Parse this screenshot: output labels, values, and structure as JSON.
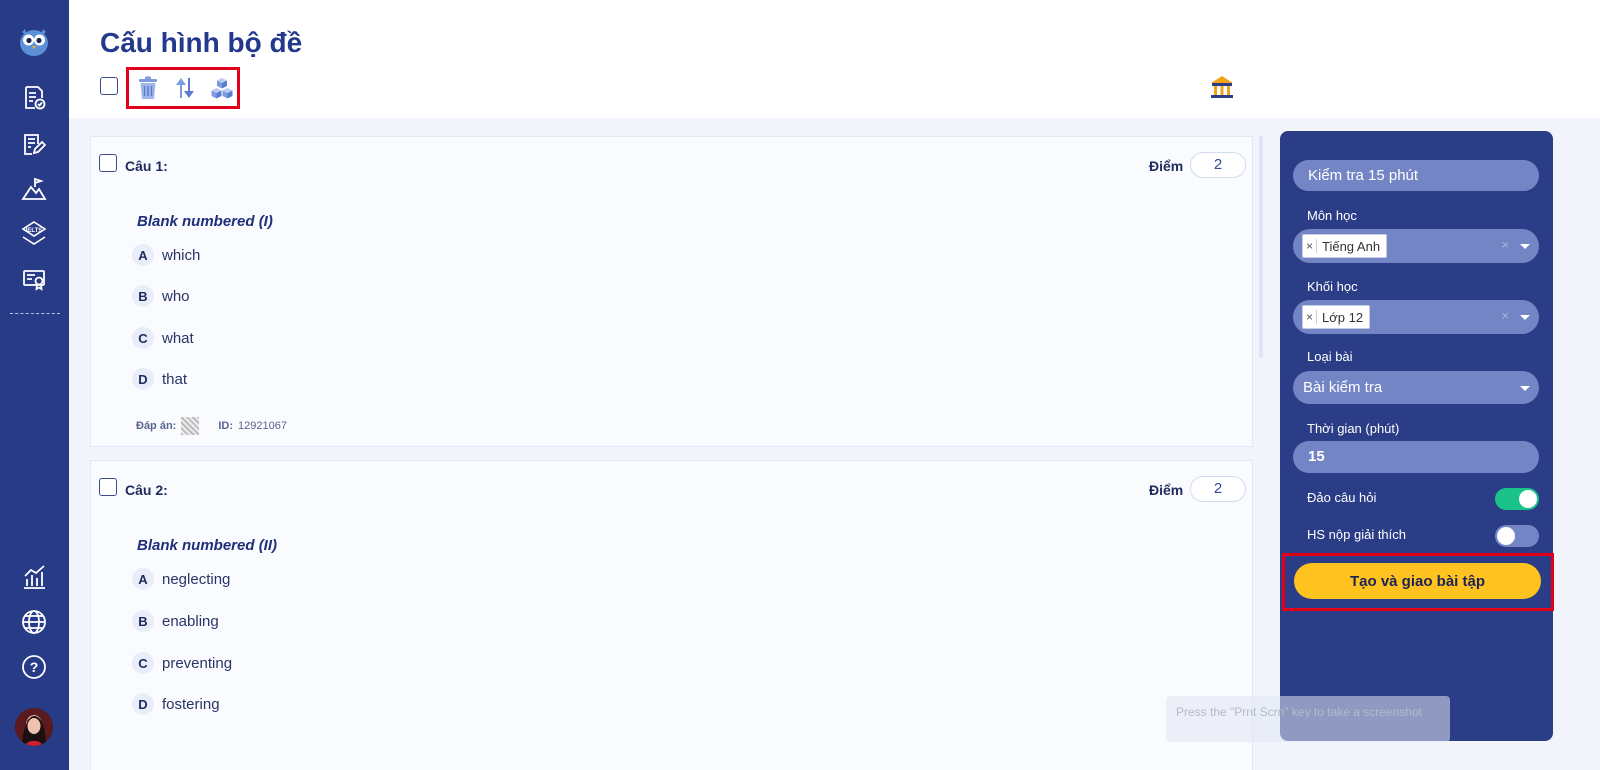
{
  "header": {
    "title": "Cấu hình bộ đề"
  },
  "sidebar": {
    "items": [
      "logo-owl",
      "exam-list",
      "edit-document",
      "mountain-flag",
      "ielts",
      "certificate",
      "analytics",
      "globe",
      "help"
    ]
  },
  "ielts_label": "IELTS",
  "questions": [
    {
      "label": "Câu 1:",
      "score_label": "Điểm",
      "score": "2",
      "text": "Blank numbered (I)",
      "options": [
        {
          "letter": "A",
          "text": "which"
        },
        {
          "letter": "B",
          "text": "who"
        },
        {
          "letter": "C",
          "text": "what"
        },
        {
          "letter": "D",
          "text": "that"
        }
      ],
      "answer_label": "Đáp án:",
      "id_label": "ID:",
      "id": "12921067"
    },
    {
      "label": "Câu 2:",
      "score_label": "Điểm",
      "score": "2",
      "text": "Blank numbered (II)",
      "options": [
        {
          "letter": "A",
          "text": "neglecting"
        },
        {
          "letter": "B",
          "text": "enabling"
        },
        {
          "letter": "C",
          "text": "preventing"
        },
        {
          "letter": "D",
          "text": "fostering"
        }
      ]
    }
  ],
  "panel": {
    "title": "Kiểm tra 15 phút",
    "subject_label": "Môn học",
    "subject_tag": "Tiếng Anh",
    "grade_label": "Khối học",
    "grade_tag": "Lớp 12",
    "tag_remove": "×",
    "clear": "×",
    "type_label": "Loại bài",
    "type_value": "Bài kiểm tra",
    "time_label": "Thời gian (phút)",
    "time_value": "15",
    "shuffle_label": "Đảo câu hỏi",
    "shuffle_on": true,
    "explain_label": "HS nộp giải thích",
    "explain_on": false,
    "submit_label": "Tạo và giao bài tập"
  },
  "toast": "Press the \"Prnt Scrn\" key to take a screenshot",
  "colors": {
    "sidebar": "#283b86",
    "panel": "#2b3d86",
    "accent_yellow": "#ffc21f",
    "toggle_on": "#19c38a",
    "highlight_red": "#e3001b"
  }
}
